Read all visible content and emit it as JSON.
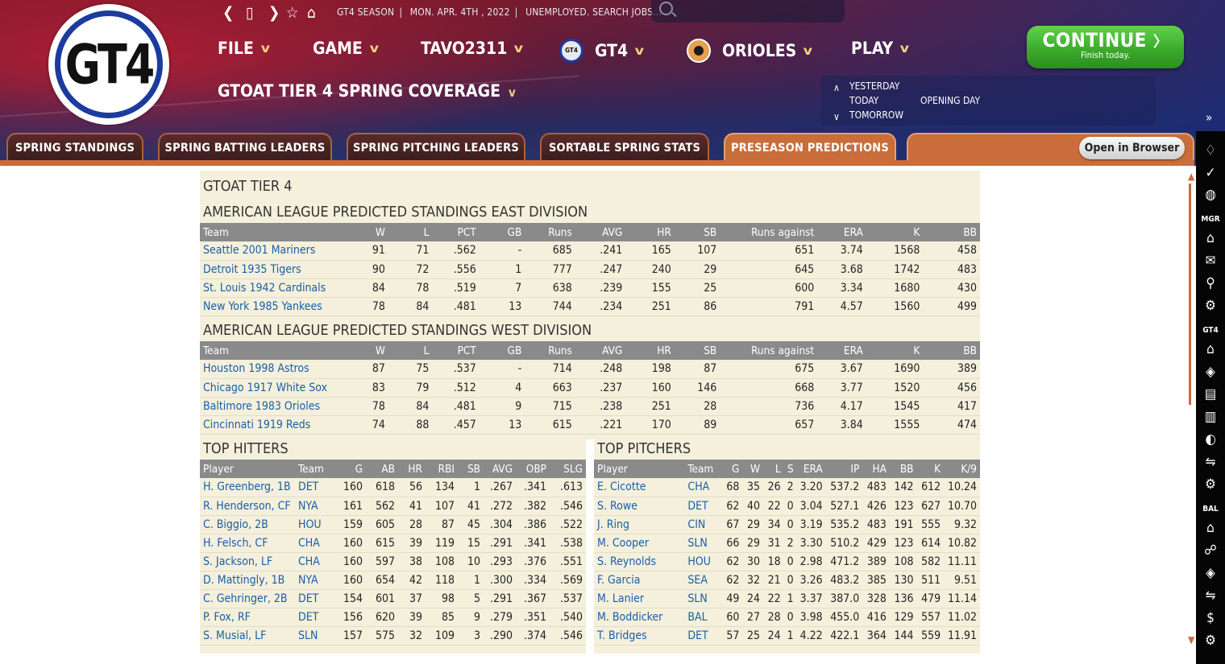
{
  "app": {
    "logo_text": "GT4"
  },
  "top_info": {
    "season": "GT4 SEASON",
    "date": "MON. APR. 4TH , 2022",
    "status": "UNEMPLOYED. SEARCH JOBS..."
  },
  "menus": [
    "FILE",
    "GAME",
    "TAVO2311",
    "GT4",
    "ORIOLES",
    "PLAY"
  ],
  "coverage_title": "GTOAT TIER 4 SPRING COVERAGE",
  "days": {
    "yesterday": "YESTERDAY",
    "today": "TODAY",
    "tomorrow": "TOMORROW",
    "event": "OPENING DAY"
  },
  "continue": {
    "label": "CONTINUE",
    "sub": "Finish today."
  },
  "tabs": [
    "SPRING STANDINGS",
    "SPRING BATTING LEADERS",
    "SPRING PITCHING LEADERS",
    "SORTABLE SPRING STATS",
    "PRESEASON PREDICTIONS"
  ],
  "open_browser": "Open in Browser",
  "sidebar_headers": {
    "mgr": "MGR",
    "gt4": "GT4",
    "bal": "BAL"
  },
  "report": {
    "league": "GTOAT TIER 4",
    "east_title": "AMERICAN LEAGUE PREDICTED STANDINGS EAST DIVISION",
    "west_title": "AMERICAN LEAGUE PREDICTED STANDINGS WEST DIVISION",
    "standings_headers": [
      "Team",
      "W",
      "L",
      "PCT",
      "GB",
      "Runs",
      "AVG",
      "HR",
      "SB",
      "Runs against",
      "ERA",
      "K",
      "BB"
    ],
    "east_rows": [
      [
        "Seattle 2001 Mariners",
        "91",
        "71",
        ".562",
        "-",
        "685",
        ".241",
        "165",
        "107",
        "651",
        "3.74",
        "1568",
        "458"
      ],
      [
        "Detroit 1935 Tigers",
        "90",
        "72",
        ".556",
        "1",
        "777",
        ".247",
        "240",
        "29",
        "645",
        "3.68",
        "1742",
        "483"
      ],
      [
        "St. Louis 1942 Cardinals",
        "84",
        "78",
        ".519",
        "7",
        "638",
        ".239",
        "155",
        "25",
        "600",
        "3.34",
        "1680",
        "430"
      ],
      [
        "New York 1985 Yankees",
        "78",
        "84",
        ".481",
        "13",
        "744",
        ".234",
        "251",
        "86",
        "791",
        "4.57",
        "1560",
        "499"
      ]
    ],
    "west_rows": [
      [
        "Houston 1998 Astros",
        "87",
        "75",
        ".537",
        "-",
        "714",
        ".248",
        "198",
        "87",
        "675",
        "3.67",
        "1690",
        "389"
      ],
      [
        "Chicago 1917 White Sox",
        "83",
        "79",
        ".512",
        "4",
        "663",
        ".237",
        "160",
        "146",
        "668",
        "3.77",
        "1520",
        "456"
      ],
      [
        "Baltimore 1983 Orioles",
        "78",
        "84",
        ".481",
        "9",
        "715",
        ".238",
        "251",
        "28",
        "736",
        "4.17",
        "1545",
        "417"
      ],
      [
        "Cincinnati 1919 Reds",
        "74",
        "88",
        ".457",
        "13",
        "615",
        ".221",
        "170",
        "89",
        "657",
        "3.84",
        "1555",
        "474"
      ]
    ],
    "hitters_title": "TOP HITTERS",
    "hitters_headers": [
      "Player",
      "Team",
      "G",
      "AB",
      "HR",
      "RBI",
      "SB",
      "AVG",
      "OBP",
      "SLG"
    ],
    "hitters": [
      [
        "H. Greenberg, 1B",
        "DET",
        "160",
        "618",
        "56",
        "134",
        "1",
        ".267",
        ".341",
        ".613"
      ],
      [
        "R. Henderson, CF",
        "NYA",
        "161",
        "562",
        "41",
        "107",
        "41",
        ".272",
        ".382",
        ".546"
      ],
      [
        "C. Biggio, 2B",
        "HOU",
        "159",
        "605",
        "28",
        "87",
        "45",
        ".304",
        ".386",
        ".522"
      ],
      [
        "H. Felsch, CF",
        "CHA",
        "160",
        "615",
        "39",
        "119",
        "15",
        ".291",
        ".341",
        ".538"
      ],
      [
        "S. Jackson, LF",
        "CHA",
        "160",
        "597",
        "38",
        "108",
        "10",
        ".293",
        ".376",
        ".551"
      ],
      [
        "D. Mattingly, 1B",
        "NYA",
        "160",
        "654",
        "42",
        "118",
        "1",
        ".300",
        ".334",
        ".569"
      ],
      [
        "C. Gehringer, 2B",
        "DET",
        "154",
        "601",
        "37",
        "98",
        "5",
        ".291",
        ".367",
        ".537"
      ],
      [
        "P. Fox, RF",
        "DET",
        "156",
        "620",
        "39",
        "85",
        "9",
        ".279",
        ".351",
        ".540"
      ],
      [
        "S. Musial, LF",
        "SLN",
        "157",
        "575",
        "32",
        "109",
        "3",
        ".290",
        ".374",
        ".546"
      ]
    ],
    "pitchers_title": "TOP PITCHERS",
    "pitchers_headers": [
      "Player",
      "Team",
      "G",
      "W",
      "L",
      "S",
      "ERA",
      "IP",
      "HA",
      "BB",
      "K",
      "K/9"
    ],
    "pitchers": [
      [
        "E. Cicotte",
        "CHA",
        "68",
        "35",
        "26",
        "2",
        "3.20",
        "537.2",
        "483",
        "142",
        "612",
        "10.24"
      ],
      [
        "S. Rowe",
        "DET",
        "62",
        "40",
        "22",
        "0",
        "3.04",
        "527.1",
        "426",
        "123",
        "627",
        "10.70"
      ],
      [
        "J. Ring",
        "CIN",
        "67",
        "29",
        "34",
        "0",
        "3.19",
        "535.2",
        "483",
        "191",
        "555",
        "9.32"
      ],
      [
        "M. Cooper",
        "SLN",
        "66",
        "29",
        "31",
        "2",
        "3.30",
        "510.2",
        "429",
        "123",
        "614",
        "10.82"
      ],
      [
        "S. Reynolds",
        "HOU",
        "62",
        "30",
        "18",
        "0",
        "2.98",
        "471.2",
        "389",
        "108",
        "582",
        "11.11"
      ],
      [
        "F. Garcia",
        "SEA",
        "62",
        "32",
        "21",
        "0",
        "3.26",
        "483.2",
        "385",
        "130",
        "511",
        "9.51"
      ],
      [
        "M. Lanier",
        "SLN",
        "49",
        "24",
        "22",
        "1",
        "3.37",
        "387.0",
        "328",
        "136",
        "479",
        "11.14"
      ],
      [
        "M. Boddicker",
        "BAL",
        "60",
        "27",
        "28",
        "0",
        "3.98",
        "455.0",
        "416",
        "129",
        "557",
        "11.02"
      ],
      [
        "T. Bridges",
        "DET",
        "57",
        "25",
        "24",
        "1",
        "4.22",
        "422.1",
        "364",
        "144",
        "559",
        "11.91"
      ]
    ]
  },
  "colors": {
    "tab_active": "#c96d3a",
    "continue_green": "#3aa82a",
    "link_blue": "#1a5ea8",
    "report_bg": "#f4f0dc",
    "header_gray": "#8a8a8a"
  }
}
